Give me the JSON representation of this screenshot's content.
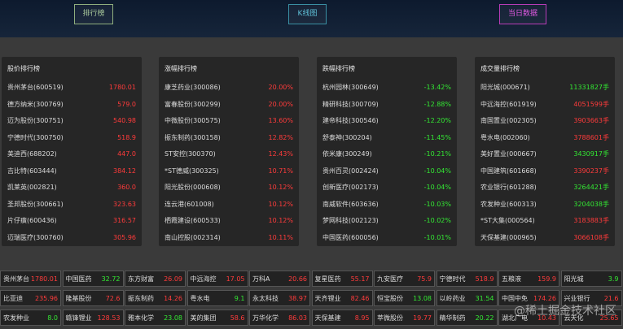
{
  "nav": {
    "rank": "排行榜",
    "kline": "K线图",
    "today": "当日数据"
  },
  "panels": {
    "price": {
      "title": "股价排行榜",
      "rows": [
        {
          "name": "贵州茅台(600519)",
          "value": "1780.01"
        },
        {
          "name": "德方纳米(300769)",
          "value": "579.0"
        },
        {
          "name": "迈为股份(300751)",
          "value": "540.98"
        },
        {
          "name": "宁德时代(300750)",
          "value": "518.9"
        },
        {
          "name": "美迪西(688202)",
          "value": "447.0"
        },
        {
          "name": "吉比特(603444)",
          "value": "384.12"
        },
        {
          "name": "凯莱英(002821)",
          "value": "360.0"
        },
        {
          "name": "圣邦股份(300661)",
          "value": "323.63"
        },
        {
          "name": "片仔癀(600436)",
          "value": "316.57"
        },
        {
          "name": "迈瑞医疗(300760)",
          "value": "305.96"
        }
      ]
    },
    "rise": {
      "title": "涨幅排行榜",
      "rows": [
        {
          "name": "康芝药业(300086)",
          "value": "20.00%"
        },
        {
          "name": "富春股份(300299)",
          "value": "20.00%"
        },
        {
          "name": "中微股份(300575)",
          "value": "13.60%"
        },
        {
          "name": "振东制药(300158)",
          "value": "12.82%"
        },
        {
          "name": "ST安控(300370)",
          "value": "12.43%"
        },
        {
          "name": "*ST德威(300325)",
          "value": "10.71%"
        },
        {
          "name": "阳光股份(000608)",
          "value": "10.12%"
        },
        {
          "name": "连云港(601008)",
          "value": "10.12%"
        },
        {
          "name": "栖霞建设(600533)",
          "value": "10.12%"
        },
        {
          "name": "南山控股(002314)",
          "value": "10.11%"
        }
      ]
    },
    "fall": {
      "title": "跌幅排行榜",
      "rows": [
        {
          "name": "杭州园林(300649)",
          "value": "-13.42%"
        },
        {
          "name": "精研科技(300709)",
          "value": "-12.88%"
        },
        {
          "name": "建帝科技(300546)",
          "value": "-12.20%"
        },
        {
          "name": "舒泰神(300204)",
          "value": "-11.45%"
        },
        {
          "name": "依米康(300249)",
          "value": "-10.21%"
        },
        {
          "name": "贵州百灵(002424)",
          "value": "-10.04%"
        },
        {
          "name": "创新医疗(002173)",
          "value": "-10.04%"
        },
        {
          "name": "南威软件(603636)",
          "value": "-10.03%"
        },
        {
          "name": "梦网科技(002123)",
          "value": "-10.02%"
        },
        {
          "name": "中国医药(600056)",
          "value": "-10.01%"
        }
      ]
    },
    "volume": {
      "title": "成交量排行榜",
      "rows": [
        {
          "name": "阳光城(000671)",
          "value": "11331827手"
        },
        {
          "name": "中远海控(601919)",
          "value": "4051599手"
        },
        {
          "name": "南国置业(002305)",
          "value": "3903663手"
        },
        {
          "name": "粤水电(002060)",
          "value": "3788601手"
        },
        {
          "name": "美好置业(000667)",
          "value": "3430917手"
        },
        {
          "name": "中国建筑(601668)",
          "value": "3390237手"
        },
        {
          "name": "农业银行(601288)",
          "value": "3264421手"
        },
        {
          "name": "农发种业(600313)",
          "value": "3204038手"
        },
        {
          "name": "*ST大集(000564)",
          "value": "3183883手"
        },
        {
          "name": "天保基建(000965)",
          "value": "3066108手"
        }
      ]
    }
  },
  "tickers": [
    [
      {
        "name": "贵州茅台",
        "value": "1780.01",
        "dir": "up"
      },
      {
        "name": "中国医药",
        "value": "32.72",
        "dir": "down"
      },
      {
        "name": "东方财富",
        "value": "26.09",
        "dir": "up"
      },
      {
        "name": "中远海控",
        "value": "17.05",
        "dir": "up"
      },
      {
        "name": "万科A",
        "value": "20.66",
        "dir": "up"
      },
      {
        "name": "复星医药",
        "value": "55.17",
        "dir": "up"
      },
      {
        "name": "九安医疗",
        "value": "75.9",
        "dir": "up"
      },
      {
        "name": "宁德时代",
        "value": "518.9",
        "dir": "up"
      },
      {
        "name": "五粮液",
        "value": "159.9",
        "dir": "up"
      },
      {
        "name": "阳光城",
        "value": "3.9",
        "dir": "down"
      }
    ],
    [
      {
        "name": "比亚迪",
        "value": "235.96",
        "dir": "up"
      },
      {
        "name": "隆基股份",
        "value": "72.6",
        "dir": "up"
      },
      {
        "name": "振东制药",
        "value": "14.26",
        "dir": "up"
      },
      {
        "name": "粤水电",
        "value": "9.1",
        "dir": "down"
      },
      {
        "name": "永太科技",
        "value": "38.97",
        "dir": "up"
      },
      {
        "name": "天齐锂业",
        "value": "82.46",
        "dir": "up"
      },
      {
        "name": "恒宝股份",
        "value": "13.08",
        "dir": "down"
      },
      {
        "name": "以岭药业",
        "value": "31.54",
        "dir": "down"
      },
      {
        "name": "中国中免",
        "value": "174.26",
        "dir": "up"
      },
      {
        "name": "兴业银行",
        "value": "21.6",
        "dir": "up"
      }
    ],
    [
      {
        "name": "农发种业",
        "value": "8.0",
        "dir": "down"
      },
      {
        "name": "赣锋锂业",
        "value": "128.53",
        "dir": "up"
      },
      {
        "name": "雅本化学",
        "value": "23.08",
        "dir": "down"
      },
      {
        "name": "美的集团",
        "value": "58.6",
        "dir": "up"
      },
      {
        "name": "万华化学",
        "value": "86.03",
        "dir": "up"
      },
      {
        "name": "天保基建",
        "value": "8.95",
        "dir": "up"
      },
      {
        "name": "萃微股份",
        "value": "19.77",
        "dir": "up"
      },
      {
        "name": "精华制药",
        "value": "20.22",
        "dir": "down"
      },
      {
        "name": "湖北广电",
        "value": "10.43",
        "dir": "up"
      },
      {
        "name": "云天化",
        "value": "25.65",
        "dir": "up"
      }
    ]
  ],
  "watermark": "@稀土掘金技术社区",
  "colors": {
    "up": "#ff3b3b",
    "down": "#33e833",
    "nav_rank": "#a8c89a",
    "nav_kline": "#5fc0d6",
    "nav_today": "#e25ae2"
  }
}
